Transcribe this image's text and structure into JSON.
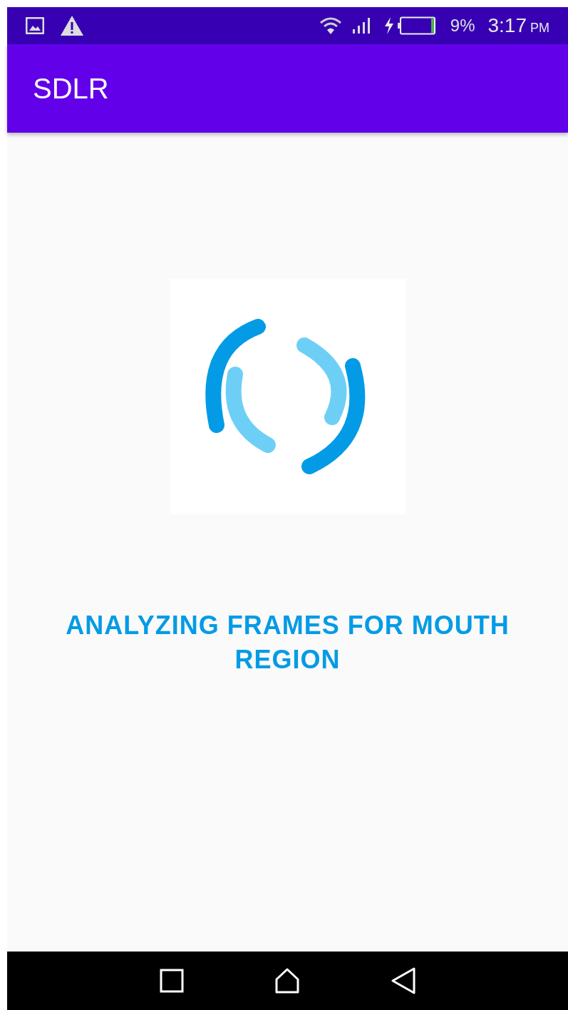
{
  "status_bar": {
    "battery": "9%",
    "time": "3:17",
    "period": "PM"
  },
  "app_bar": {
    "title": "SDLR"
  },
  "content": {
    "message": "ANALYZING FRAMES FOR MOUTH REGION"
  }
}
